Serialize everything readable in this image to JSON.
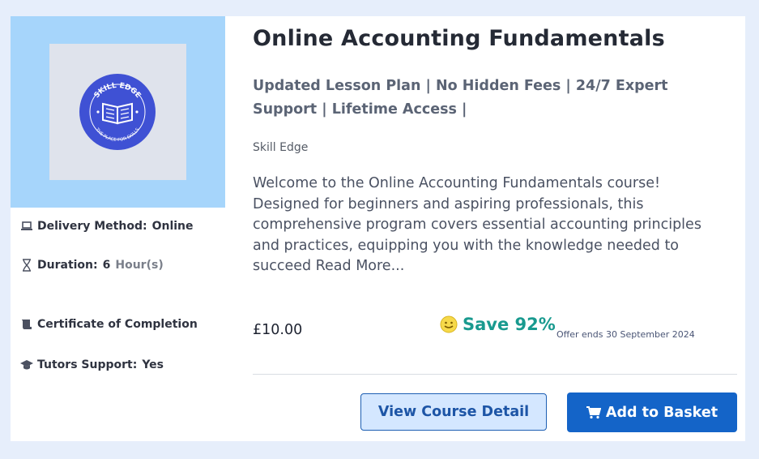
{
  "course": {
    "title": "Online Accounting Fundamentals",
    "highlights": "Updated Lesson Plan | No Hidden Fees | 24/7 Expert Support | Lifetime Access |",
    "provider": "Skill Edge",
    "description": "Welcome to the Online Accounting Fundamentals course! Designed for beginners and aspiring professionals, this comprehensive program covers essential accounting principles and practices, equipping you with the knowledge needed to succeed Read More...",
    "logo": {
      "top_text": "SKILL EDGE",
      "bottom_text": "THE PLACE FOR SKILLS"
    }
  },
  "meta": {
    "delivery_label": "Delivery Method:",
    "delivery_value": "Online",
    "duration_label": "Duration:",
    "duration_value": "6",
    "duration_unit": "Hour(s)",
    "certificate": "Certificate of Completion",
    "tutors_label": "Tutors Support:",
    "tutors_value": "Yes"
  },
  "pricing": {
    "price": "£10.00",
    "save": "Save 92%",
    "offer": "Offer ends 30 September 2024"
  },
  "actions": {
    "view_detail": "View Course Detail",
    "add_to_basket": "Add to Basket"
  },
  "icons": {
    "delivery": "laptop-icon",
    "duration": "hourglass-icon",
    "certificate": "certificate-icon",
    "tutors": "graduation-cap-icon",
    "save": "smile-icon",
    "basket": "cart-icon"
  },
  "colors": {
    "thumbnail_bg": "#a6d5fb",
    "logo": "#3f51d4",
    "save_text": "#199a8f",
    "primary_button": "#1464c8",
    "secondary_button_bg": "#d4e7ff"
  }
}
